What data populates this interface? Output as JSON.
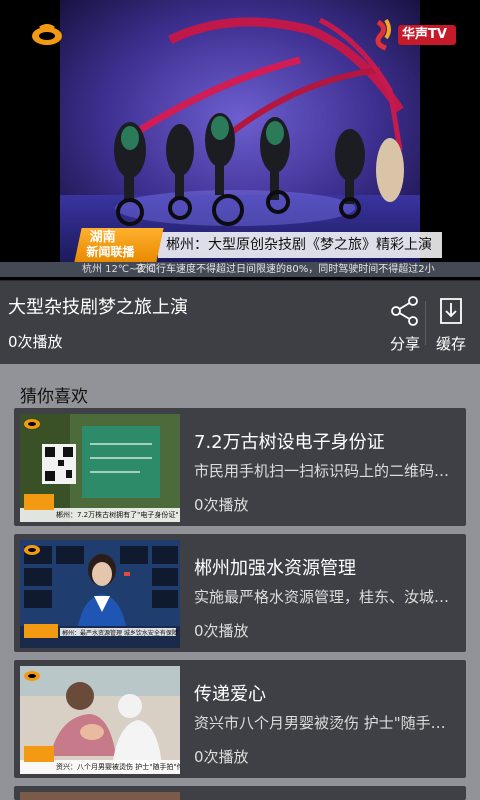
{
  "player": {
    "channel_logo": "hunan-tv-mango-logo",
    "station_logo_text": "华声TV",
    "show_badge_line1": "湖南",
    "show_badge_line2": "新闻联播",
    "headline": "郴州：大型原创杂技剧《梦之旅》精彩上演",
    "ticker_city": "杭州  12℃~2℃",
    "ticker_text": "夜间行车速度不得超过日间限速的80%，同时驾驶时间不得超过2小"
  },
  "info": {
    "title": "大型杂技剧梦之旅上演",
    "play_count": "0次播放",
    "share_label": "分享",
    "cache_label": "缓存"
  },
  "recommend": {
    "title": "猜你喜欢",
    "items": [
      {
        "title": "7.2万古树设电子身份证",
        "desc": "市民用手机扫一扫标识码上的二维码…",
        "count": "0次播放",
        "thumb_caption": "郴州：7.2万株古树拥有了\"电子身份证\""
      },
      {
        "title": "郴州加强水资源管理",
        "desc": "实施最严格水资源管理，桂东、汝城…",
        "count": "0次播放",
        "thumb_caption": "郴州：最严水资源管理 城乡饮水安全有保障"
      },
      {
        "title": "传递爱心",
        "desc": "资兴市八个月男婴被烫伤 护士\"随手…",
        "count": "0次播放",
        "thumb_caption": "资兴：八个月男婴被烫伤 护士\"随手拍\"传递爱心"
      }
    ]
  },
  "colors": {
    "accent_orange": "#f39a12",
    "card_bg": "#3f4046",
    "recommend_bg": "#929398"
  }
}
